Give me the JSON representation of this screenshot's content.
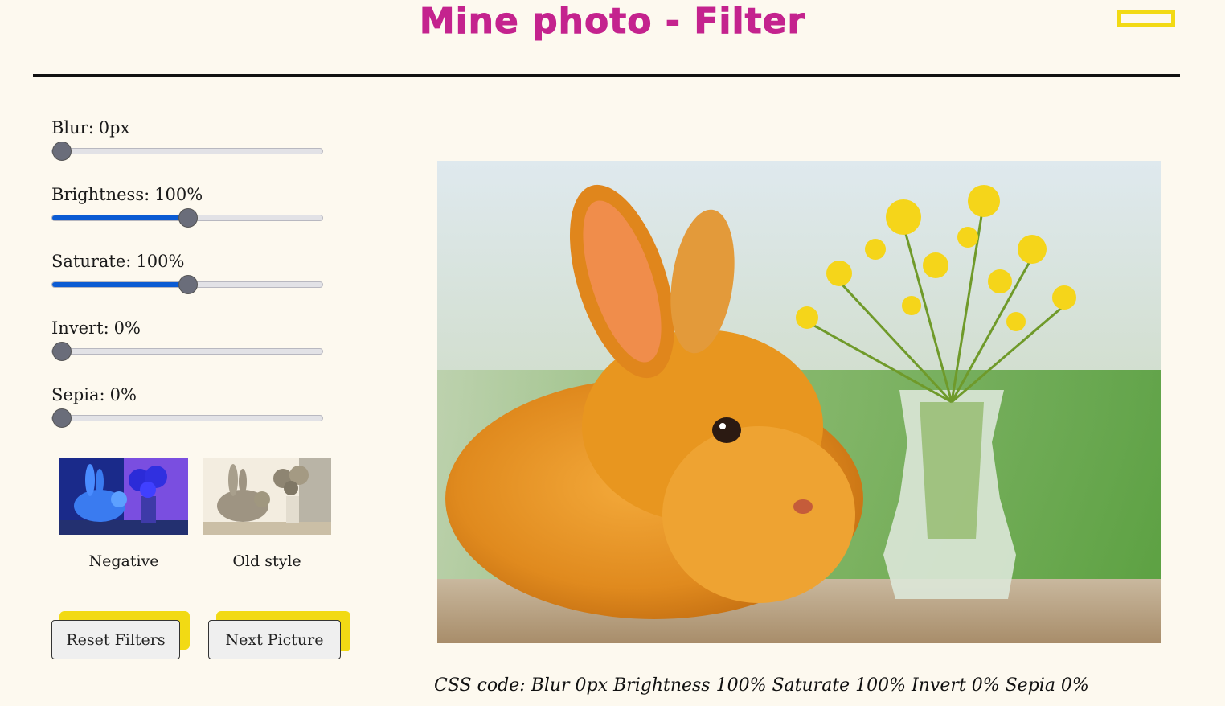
{
  "header": {
    "title": "Mine photo - Filter"
  },
  "sliders": [
    {
      "name": "Blur",
      "label": "Blur:",
      "value_text": "0px",
      "value": 0,
      "max": 20
    },
    {
      "name": "Brightness",
      "label": "Brightness:",
      "value_text": "100%",
      "value": 100,
      "max": 200
    },
    {
      "name": "Saturate",
      "label": "Saturate:",
      "value_text": "100%",
      "value": 100,
      "max": 200
    },
    {
      "name": "Invert",
      "label": "Invert:",
      "value_text": "0%",
      "value": 0,
      "max": 100
    },
    {
      "name": "Sepia",
      "label": "Sepia:",
      "value_text": "0%",
      "value": 0,
      "max": 100
    }
  ],
  "presets": [
    {
      "label": "Negative"
    },
    {
      "label": "Old style"
    }
  ],
  "buttons": {
    "reset": "Reset Filters",
    "next": "Next Picture"
  },
  "css_code": "CSS code: Blur 0px Brightness 100% Saturate 100% Invert 0% Sepia 0%",
  "colors": {
    "accent": "#c4238e",
    "highlight": "#f2da14",
    "slider_fill": "#0b5bd3",
    "background": "#fdf9ef"
  }
}
